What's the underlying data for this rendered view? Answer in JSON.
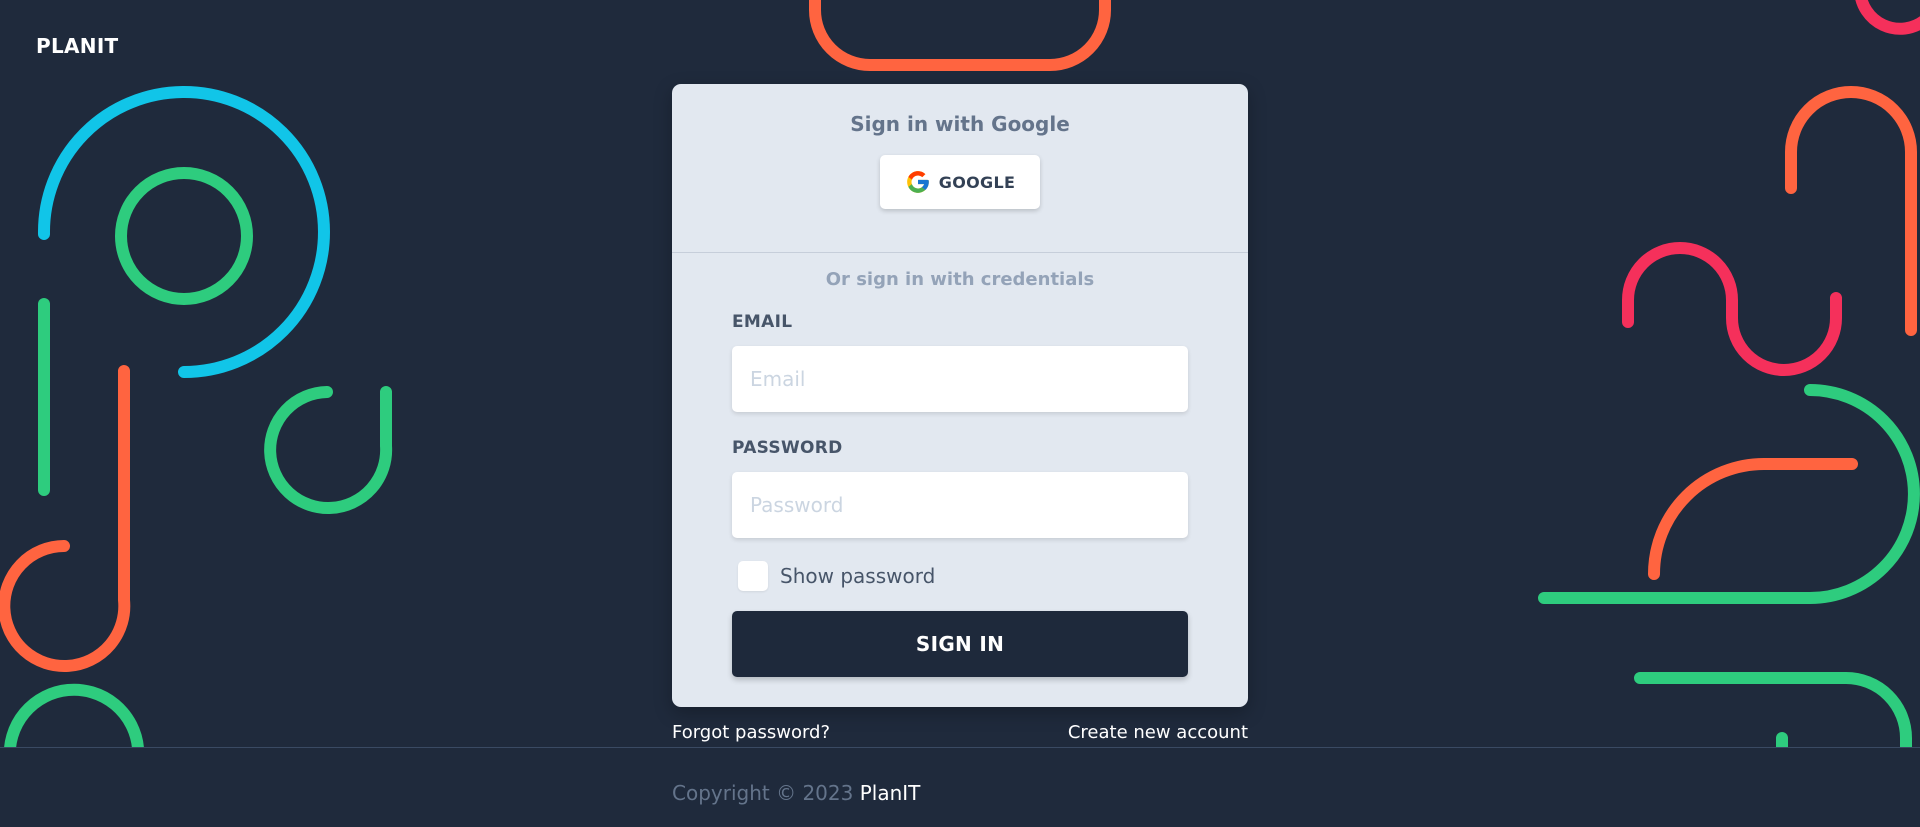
{
  "brand": "PLANIT",
  "card": {
    "google_heading": "Sign in with Google",
    "google_button_label": "GOOGLE",
    "credentials_heading": "Or sign in with credentials",
    "email": {
      "label": "EMAIL",
      "placeholder": "Email",
      "value": ""
    },
    "password": {
      "label": "PASSWORD",
      "placeholder": "Password",
      "value": ""
    },
    "show_password_label": "Show password",
    "show_password_checked": false,
    "signin_button_label": "SIGN IN"
  },
  "links": {
    "forgot_password": "Forgot password?",
    "create_account": "Create new account"
  },
  "footer": {
    "copyright": "Copyright © 2023",
    "brand_link": "PlanIT"
  },
  "colors": {
    "background": "#1f2a3c",
    "card": "#e2e8f0",
    "button_dark": "#1e293b",
    "deco_blue": "#11c5e8",
    "deco_green": "#2ecc7e",
    "deco_orange": "#ff6440",
    "deco_pink": "#f5305b"
  },
  "icons": {
    "google": "google-logo-icon"
  }
}
